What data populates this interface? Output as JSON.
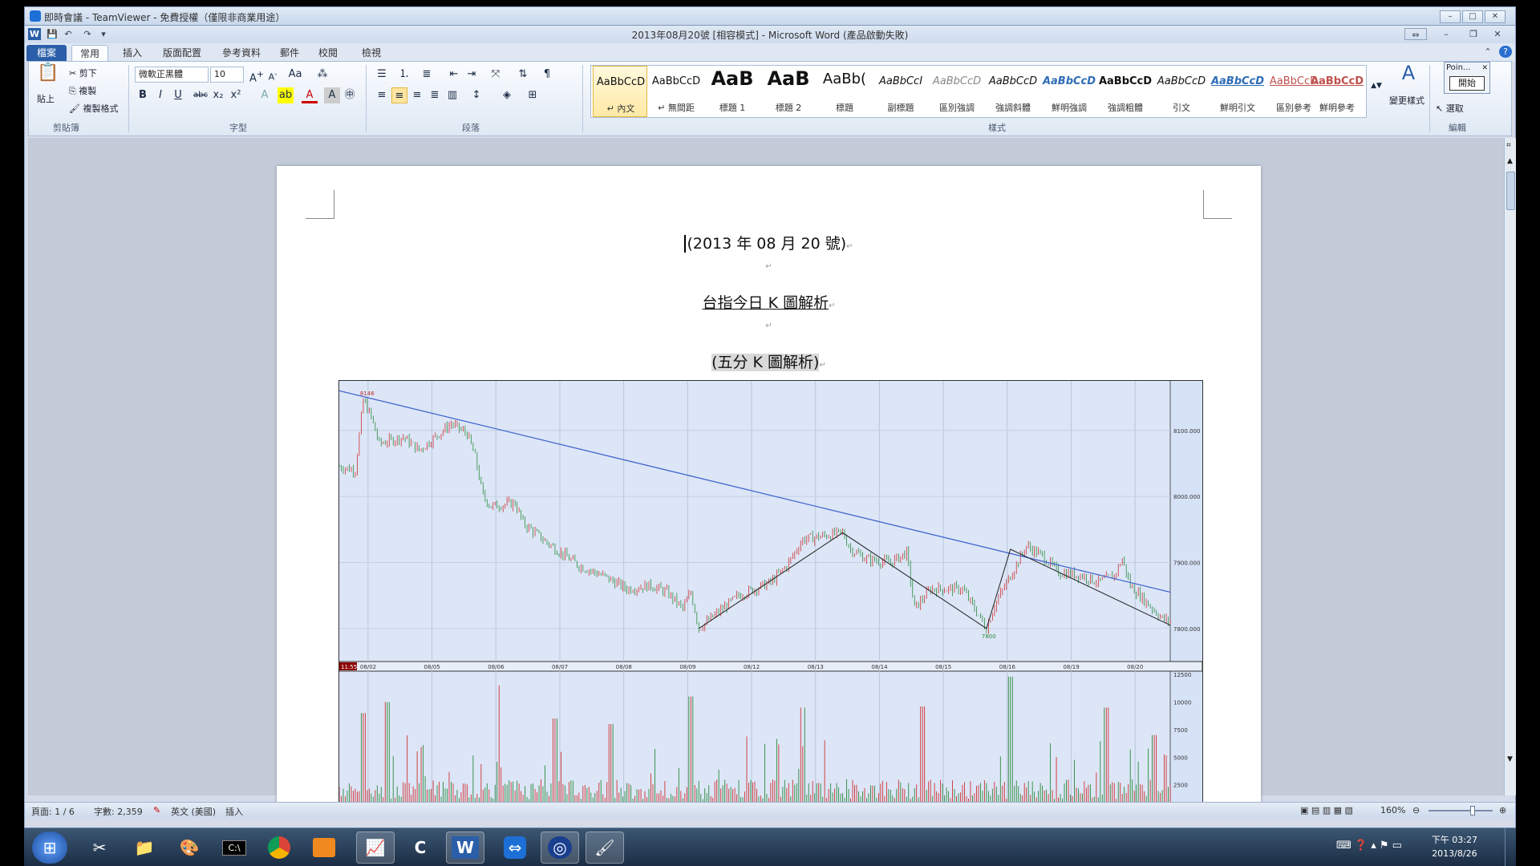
{
  "teamviewer": {
    "title": "即時會議 - TeamViewer - 免費授權（僅限非商業用途）"
  },
  "word": {
    "title": "2013年08月20號 [相容模式] - Microsoft Word (產品啟動失敗)",
    "tabs": [
      "檔案",
      "常用",
      "插入",
      "版面配置",
      "參考資料",
      "郵件",
      "校閱",
      "檢視"
    ],
    "clipboard": {
      "paste": "貼上",
      "cut": "剪下",
      "copy": "複製",
      "format_painter": "複製格式",
      "group": "剪貼簿"
    },
    "font": {
      "name": "微軟正黑體",
      "size": "10",
      "group": "字型"
    },
    "paragraph": {
      "group": "段落"
    },
    "styles": {
      "group": "樣式",
      "items": [
        {
          "preview": "AaBbCcD",
          "name": "↵ 內文"
        },
        {
          "preview": "AaBbCcD",
          "name": "↵ 無間距"
        },
        {
          "preview": "AaB",
          "name": "標題 1"
        },
        {
          "preview": "AaB",
          "name": "標題 2"
        },
        {
          "preview": "AaBb(",
          "name": "標題"
        },
        {
          "preview": "AaBbCcI",
          "name": "副標題"
        },
        {
          "preview": "AaBbCcD",
          "name": "區別強調"
        },
        {
          "preview": "AaBbCcD",
          "name": "強調斜體"
        },
        {
          "preview": "AaBbCcD",
          "name": "鮮明強調"
        },
        {
          "preview": "AaBbCcD",
          "name": "強調粗體"
        },
        {
          "preview": "AaBbCcD",
          "name": "引文"
        },
        {
          "preview": "AaBbCcD",
          "name": "鮮明引文"
        },
        {
          "preview": "AaBbCcD",
          "name": "區別參考"
        },
        {
          "preview": "AaBbCcD",
          "name": "鮮明參考"
        }
      ],
      "change": "變更樣式"
    },
    "editing": {
      "group": "編輯",
      "select": "選取",
      "popup_title": "Poin...",
      "popup_button": "開始"
    },
    "document": {
      "line1": "(2013 年 08 月 20 號)",
      "line2": "台指今日 K 圖解析",
      "line3": "(五分 K 圖解析)"
    },
    "status": {
      "page": "頁面: 1 / 6",
      "words": "字數: 2,359",
      "lang": "英文 (美國)",
      "mode": "插入",
      "zoom": "160%"
    }
  },
  "chart_data": {
    "type": "line",
    "title": "",
    "time_label": "11:55",
    "price_labels": [
      "8100.000",
      "8000.000",
      "7900.000",
      "7800.000"
    ],
    "volume_labels": [
      "12500",
      "10000",
      "7500",
      "5000",
      "2500"
    ],
    "x_dates": [
      "08/02",
      "08/05",
      "08/06",
      "08/07",
      "08/08",
      "08/09",
      "08/12",
      "08/13",
      "08/14",
      "08/15",
      "08/16",
      "08/19",
      "08/20"
    ],
    "annotations": [
      "8146",
      "7800"
    ],
    "price_path": [
      [
        0,
        8045
      ],
      [
        2,
        8040
      ],
      [
        3,
        8146
      ],
      [
        4,
        8120
      ],
      [
        5,
        8080
      ],
      [
        8,
        8090
      ],
      [
        10,
        8070
      ],
      [
        14,
        8110
      ],
      [
        16,
        8095
      ],
      [
        17,
        8060
      ],
      [
        18,
        8000
      ],
      [
        19,
        7985
      ],
      [
        22,
        7990
      ],
      [
        23,
        7960
      ],
      [
        26,
        7930
      ],
      [
        30,
        7895
      ],
      [
        33,
        7880
      ],
      [
        36,
        7860
      ],
      [
        39,
        7865
      ],
      [
        41,
        7855
      ],
      [
        43,
        7830
      ],
      [
        44,
        7855
      ],
      [
        45,
        7800
      ],
      [
        47,
        7820
      ],
      [
        50,
        7850
      ],
      [
        54,
        7870
      ],
      [
        56,
        7895
      ],
      [
        58,
        7935
      ],
      [
        63,
        7945
      ],
      [
        64,
        7920
      ],
      [
        66,
        7905
      ],
      [
        69,
        7900
      ],
      [
        71,
        7915
      ],
      [
        72,
        7830
      ],
      [
        74,
        7860
      ],
      [
        78,
        7860
      ],
      [
        81,
        7800
      ],
      [
        82,
        7835
      ],
      [
        84,
        7880
      ],
      [
        86,
        7925
      ],
      [
        88,
        7910
      ],
      [
        90,
        7885
      ],
      [
        93,
        7880
      ],
      [
        95,
        7870
      ],
      [
        97,
        7880
      ],
      [
        98,
        7905
      ],
      [
        99,
        7865
      ],
      [
        101,
        7840
      ],
      [
        103,
        7815
      ],
      [
        104,
        7810
      ]
    ],
    "trendline": [
      [
        0,
        8160
      ],
      [
        104,
        7855
      ]
    ],
    "zigzag": [
      [
        45,
        7800
      ],
      [
        63,
        7945
      ],
      [
        81,
        7800
      ],
      [
        84,
        7920
      ],
      [
        104,
        7805
      ]
    ],
    "volume": [
      [
        3,
        9000
      ],
      [
        6,
        10000
      ],
      [
        20,
        11500
      ],
      [
        27,
        8500
      ],
      [
        34,
        8000
      ],
      [
        44,
        10500
      ],
      [
        58,
        9500
      ],
      [
        73,
        9600
      ],
      [
        84,
        12300
      ],
      [
        96,
        9500
      ],
      [
        102,
        7000
      ]
    ]
  },
  "taskbar": {
    "time": "下午 03:27",
    "date": "2013/8/26"
  }
}
